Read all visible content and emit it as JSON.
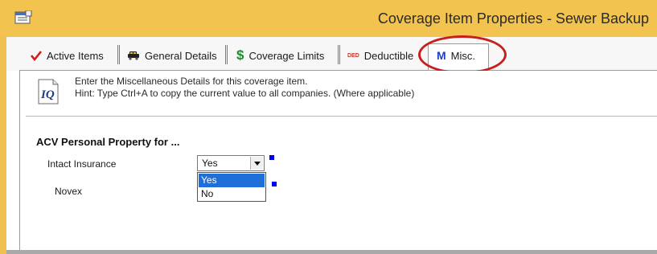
{
  "window": {
    "title": "Coverage Item Properties - Sewer Backup",
    "icon": "properties-grid-icon"
  },
  "tabs": [
    {
      "label": "Active Items",
      "icon": "checkmark-icon",
      "icon_color": "#d21d1d"
    },
    {
      "label": "General Details",
      "icon": "car-icon"
    },
    {
      "label": "Coverage Limits",
      "icon": "dollar-icon",
      "icon_color": "#1f8a2c"
    },
    {
      "label": "Deductible",
      "icon": "ded-icon",
      "icon_text": "DED",
      "icon_color": "#c0392b"
    },
    {
      "label": "Misc.",
      "icon": "m-icon",
      "icon_text": "M",
      "icon_color": "#1f3fbf",
      "active": true
    }
  ],
  "info": {
    "icon_text": "IQ",
    "line1": "Enter the Miscellaneous Details for this coverage item.",
    "line2": "Hint: Type Ctrl+A to copy the current value to all companies. (Where applicable)"
  },
  "section": {
    "heading": "ACV Personal Property for ...",
    "rows": [
      {
        "label": "Intact Insurance",
        "value": "Yes"
      },
      {
        "label": "Novex",
        "value": ""
      }
    ]
  },
  "dropdown": {
    "options": [
      "Yes",
      "No"
    ],
    "selected": "Yes"
  },
  "colors": {
    "titlebar": "#f2c34e",
    "highlight": "#1e6fd9",
    "marker": "#0000ee",
    "callout": "#c81e1e"
  }
}
